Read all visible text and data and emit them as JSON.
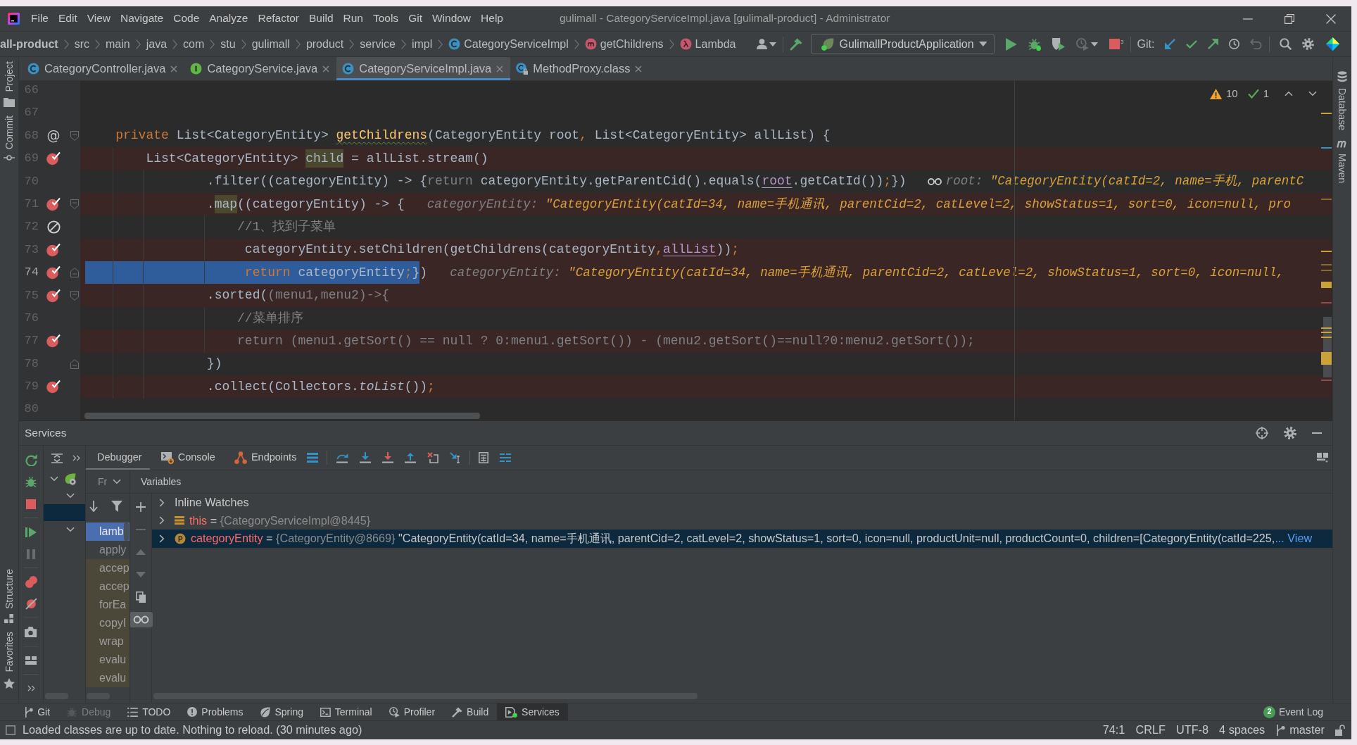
{
  "window": {
    "title": "gulimall - CategoryServiceImpl.java [gulimall-product] - Administrator"
  },
  "menu": [
    "File",
    "Edit",
    "View",
    "Navigate",
    "Code",
    "Analyze",
    "Refactor",
    "Build",
    "Run",
    "Tools",
    "Git",
    "Window",
    "Help"
  ],
  "navigation": {
    "breadcrumb": [
      {
        "label": "all-product",
        "kind": "module"
      },
      {
        "label": "src",
        "kind": "folder"
      },
      {
        "label": "main",
        "kind": "folder"
      },
      {
        "label": "java",
        "kind": "folder"
      },
      {
        "label": "com",
        "kind": "folder"
      },
      {
        "label": "stu",
        "kind": "folder"
      },
      {
        "label": "gulimall",
        "kind": "folder"
      },
      {
        "label": "product",
        "kind": "folder"
      },
      {
        "label": "service",
        "kind": "folder"
      },
      {
        "label": "impl",
        "kind": "folder"
      },
      {
        "label": "CategoryServiceImpl",
        "kind": "class"
      },
      {
        "label": "getChildrens",
        "kind": "method"
      },
      {
        "label": "Lambda",
        "kind": "lambda"
      }
    ],
    "run_configuration": "GulimallProductApplication",
    "run_actions": [
      {
        "kind": "run",
        "disabled": false
      },
      {
        "kind": "debug",
        "disabled": false
      },
      {
        "kind": "coverage",
        "disabled": false
      },
      {
        "kind": "profile",
        "disabled": true
      },
      {
        "kind": "stop",
        "disabled": false,
        "badge": "3"
      }
    ],
    "git_label": "Git:",
    "git_actions": [
      {
        "kind": "update",
        "disabled": false
      },
      {
        "kind": "commit",
        "disabled": false
      },
      {
        "kind": "push",
        "disabled": false
      },
      {
        "kind": "history",
        "disabled": false
      },
      {
        "kind": "rollback",
        "disabled": true
      }
    ]
  },
  "tool_stripes": {
    "left_top": [
      {
        "label": "Project",
        "kind": "project"
      },
      {
        "label": "Commit",
        "kind": "commit"
      }
    ],
    "left_bottom": [
      {
        "label": "Structure",
        "kind": "structure"
      },
      {
        "label": "Favorites",
        "kind": "favorites"
      }
    ],
    "right": [
      {
        "label": "Database",
        "kind": "database"
      },
      {
        "label": "Maven",
        "kind": "maven"
      }
    ]
  },
  "editor": {
    "tabs": [
      {
        "label": "CategoryController.java",
        "kind": "class",
        "selected": false
      },
      {
        "label": "CategoryService.java",
        "kind": "interface",
        "selected": false
      },
      {
        "label": "CategoryServiceImpl.java",
        "kind": "class",
        "selected": true
      },
      {
        "label": "MethodProxy.class",
        "kind": "locked-class",
        "selected": false
      }
    ],
    "inspections": {
      "warnings": "10",
      "weak_warnings": "1"
    },
    "lines": [
      {
        "number": "66",
        "current": false
      },
      {
        "number": "67",
        "current": false
      },
      {
        "number": "68",
        "current": false,
        "gutter_mark": "@",
        "markers": [
          {
            "kind": "fold-start"
          }
        ],
        "tokens": [
          {
            "text": "    private",
            "kind": "keyword"
          },
          {
            "text": " List<CategoryEntity> ",
            "kind": "plain"
          },
          {
            "text": "getChildrens",
            "kind": "declaration"
          },
          {
            "text": "(CategoryEntity root",
            "kind": "plain"
          },
          {
            "text": ",",
            "kind": "punctuation"
          },
          {
            "text": " List<CategoryEntity> allList) {",
            "kind": "plain"
          }
        ]
      },
      {
        "number": "69",
        "current": false,
        "markers": [
          {
            "kind": "breakpoint",
            "enabled": true
          }
        ],
        "tokens": [
          {
            "text": "        List<CategoryEntity> ",
            "kind": "plain"
          },
          {
            "text": "child",
            "kind": "marked"
          },
          {
            "text": " = allList.stream()",
            "kind": "plain"
          }
        ]
      },
      {
        "number": "70",
        "current": false,
        "tokens": [
          {
            "text": "                .filter((categoryEntity) -> {",
            "kind": "plain"
          },
          {
            "text": "return",
            "kind": "dim"
          },
          {
            "text": " categoryEntity.getParentCid().equals(",
            "kind": "plain"
          },
          {
            "text": "root",
            "kind": "captured"
          },
          {
            "text": ".getCatId())",
            "kind": "plain"
          },
          {
            "text": ";",
            "kind": "punctuation"
          },
          {
            "text": "})",
            "kind": "plain"
          }
        ],
        "hint": {
          "watch": true,
          "label": "root:",
          "value": "\"CategoryEntity(catId=2, name=手机, parentC"
        }
      },
      {
        "number": "71",
        "current": false,
        "markers": [
          {
            "kind": "breakpoint",
            "enabled": true
          },
          {
            "kind": "fold-start"
          }
        ],
        "tokens": [
          {
            "text": "                .",
            "kind": "plain"
          },
          {
            "text": "map",
            "kind": "marked"
          },
          {
            "text": "((categoryEntity) -> {",
            "kind": "plain"
          }
        ],
        "hint": {
          "watch": false,
          "label": "categoryEntity:",
          "value": "\"CategoryEntity(catId=34, name=手机通讯, parentCid=2, catLevel=2, showStatus=1, sort=0, icon=null, pro"
        }
      },
      {
        "number": "72",
        "current": false,
        "markers": [
          {
            "kind": "breakpoint",
            "enabled": false
          }
        ],
        "tokens": [
          {
            "text": "                    //1、找到子菜单",
            "kind": "comment"
          }
        ]
      },
      {
        "number": "73",
        "current": false,
        "markers": [
          {
            "kind": "breakpoint",
            "enabled": true
          }
        ],
        "tokens": [
          {
            "text": "                     categoryEntity.setChildren(getChildrens(categoryEntity",
            "kind": "plain"
          },
          {
            "text": ",",
            "kind": "punctuation"
          },
          {
            "text": "allList",
            "kind": "captured"
          },
          {
            "text": "))",
            "kind": "plain"
          },
          {
            "text": ";",
            "kind": "punctuation"
          }
        ]
      },
      {
        "number": "74",
        "current": true,
        "markers": [
          {
            "kind": "breakpoint",
            "enabled": true
          },
          {
            "kind": "fold-end"
          }
        ],
        "current_tokens": [
          {
            "text": "                     return",
            "kind": "keyword"
          },
          {
            "text": " categoryEntity",
            "kind": "plain"
          },
          {
            "text": ";",
            "kind": "punctuation"
          },
          {
            "text": "}",
            "kind": "plain"
          }
        ],
        "tokens": [
          {
            "text": ")",
            "kind": "plain"
          }
        ],
        "hint": {
          "watch": false,
          "label": "categoryEntity:",
          "value": "\"CategoryEntity(catId=34, name=手机通讯, parentCid=2, catLevel=2, showStatus=1, sort=0, icon=null,"
        }
      },
      {
        "number": "75",
        "current": false,
        "markers": [
          {
            "kind": "breakpoint",
            "enabled": true
          },
          {
            "kind": "fold-start"
          }
        ],
        "tokens": [
          {
            "text": "                .sorted(",
            "kind": "plain"
          },
          {
            "text": "(menu1,menu2)->{",
            "kind": "dim"
          }
        ]
      },
      {
        "number": "76",
        "current": false,
        "tokens": [
          {
            "text": "                    //菜单排序",
            "kind": "comment"
          }
        ]
      },
      {
        "number": "77",
        "current": false,
        "markers": [
          {
            "kind": "breakpoint",
            "enabled": true
          }
        ],
        "tokens": [
          {
            "text": "                    return (menu1.getSort() == null ? 0:menu1.getSort()) - (menu2.getSort()==null?0:menu2.getSort());",
            "kind": "dim"
          }
        ]
      },
      {
        "number": "78",
        "current": false,
        "markers": [
          {
            "kind": "fold-end"
          }
        ],
        "tokens": [
          {
            "text": "                })",
            "kind": "plain"
          }
        ]
      },
      {
        "number": "79",
        "current": false,
        "markers": [
          {
            "kind": "breakpoint",
            "enabled": true
          }
        ],
        "tokens": [
          {
            "text": "                .collect(Collectors.",
            "kind": "plain"
          },
          {
            "text": "toList",
            "kind": "static"
          },
          {
            "text": "())",
            "kind": "plain"
          },
          {
            "text": ";",
            "kind": "punctuation"
          }
        ]
      },
      {
        "number": "80",
        "current": false
      }
    ]
  },
  "services": {
    "title": "Services",
    "actions": [
      [
        {
          "kind": "rerun",
          "disabled": false
        },
        {
          "kind": "debug-rerun",
          "disabled": false
        },
        {
          "kind": "stop",
          "disabled": false
        }
      ],
      [
        {
          "kind": "resume",
          "disabled": false
        },
        {
          "kind": "pause",
          "disabled": true
        }
      ],
      [
        {
          "kind": "view-breakpoints",
          "disabled": false
        },
        {
          "kind": "mute-breakpoints",
          "disabled": false
        }
      ],
      [
        {
          "kind": "camera",
          "disabled": false
        }
      ],
      [
        {
          "kind": "layout",
          "disabled": false
        }
      ],
      [
        {
          "kind": "more",
          "disabled": false
        }
      ]
    ],
    "tree": [
      {
        "kind": "spring-boot",
        "expanded": true,
        "selected": false,
        "children": [
          {
            "expanded": true,
            "selected": false,
            "children": [
              {
                "selected": true
              }
            ]
          },
          {
            "expanded": true,
            "selected": false
          }
        ]
      }
    ],
    "debugger": {
      "tabs": [
        {
          "label": "Debugger",
          "kind": "debugger",
          "selected": true
        },
        {
          "label": "Console",
          "kind": "console",
          "selected": false
        },
        {
          "label": "Endpoints",
          "kind": "endpoints",
          "selected": false
        }
      ],
      "frames": {
        "header": "Fr",
        "items": [
          {
            "label": "lamb",
            "selected": true,
            "library": false
          },
          {
            "label": "apply",
            "selected": false,
            "library": false
          },
          {
            "label": "accep",
            "selected": false,
            "library": true
          },
          {
            "label": "accep",
            "selected": false,
            "library": true
          },
          {
            "label": "forEa",
            "selected": false,
            "library": true
          },
          {
            "label": "copyI",
            "selected": false,
            "library": true
          },
          {
            "label": "wrap",
            "selected": false,
            "library": true
          },
          {
            "label": "evalu",
            "selected": false,
            "library": true
          },
          {
            "label": "evalu",
            "selected": false,
            "library": true
          }
        ]
      },
      "variables": {
        "header": "Variables",
        "toolbar": [
          {
            "kind": "add",
            "disabled": false,
            "on": false
          },
          {
            "kind": "remove",
            "disabled": true,
            "on": false
          },
          {
            "kind": "move-up",
            "disabled": true,
            "on": false
          },
          {
            "kind": "move-down",
            "disabled": true,
            "on": false
          },
          {
            "kind": "copy",
            "disabled": false,
            "on": false
          },
          {
            "kind": "watches",
            "disabled": false,
            "on": true
          }
        ],
        "items": [
          {
            "kind": "watches",
            "name": "Inline Watches",
            "expanded": false,
            "selected": false
          },
          {
            "kind": "object",
            "name": "this",
            "separator": "=",
            "reference": "{CategoryServiceImpl@8445}",
            "expanded": false,
            "selected": false
          },
          {
            "kind": "parameter",
            "name": "categoryEntity",
            "separator": "=",
            "reference": "{CategoryEntity@8669}",
            "value": "\"CategoryEntity(catId=34, name=手机通讯, parentCid=2, catLevel=2, showStatus=1, sort=0, icon=null, productUnit=null, productCount=0, children=[CategoryEntity(catId=225,",
            "link": "... View",
            "expanded": false,
            "selected": true
          }
        ]
      }
    }
  },
  "tool_windows": [
    {
      "label": "Git",
      "kind": "git",
      "selected": false,
      "disabled": false
    },
    {
      "label": "Debug",
      "kind": "debug",
      "selected": false,
      "disabled": true
    },
    {
      "label": "TODO",
      "kind": "todo",
      "selected": false,
      "disabled": false
    },
    {
      "label": "Problems",
      "kind": "problems",
      "selected": false,
      "disabled": false
    },
    {
      "label": "Spring",
      "kind": "spring",
      "selected": false,
      "disabled": false
    },
    {
      "label": "Terminal",
      "kind": "terminal",
      "selected": false,
      "disabled": false
    },
    {
      "label": "Profiler",
      "kind": "profiler",
      "selected": false,
      "disabled": false
    },
    {
      "label": "Build",
      "kind": "build",
      "selected": false,
      "disabled": false
    },
    {
      "label": "Services",
      "kind": "services",
      "selected": true,
      "disabled": false
    }
  ],
  "event_log": {
    "count": "2",
    "label": "Event Log"
  },
  "status_bar": {
    "message": "Loaded classes are up to date. Nothing to reload. (30 minutes ago)",
    "position": "74:1",
    "line_separator": "CRLF",
    "encoding": "UTF-8",
    "indent": "4 spaces",
    "branch": "master"
  }
}
